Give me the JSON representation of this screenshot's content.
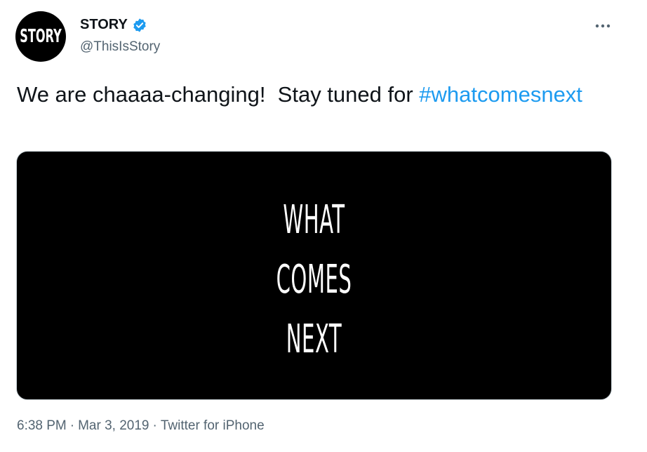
{
  "author": {
    "avatar_text": "STORY",
    "name": "STORY",
    "handle": "@ThisIsStory",
    "verified": true
  },
  "tweet": {
    "text": "We are chaaaa-changing!  Stay tuned for ",
    "hashtag": "#whatcomesnext"
  },
  "media": {
    "lines": [
      "WHAT",
      "COMES",
      "NEXT"
    ]
  },
  "meta": {
    "time": "6:38 PM",
    "date": "Mar 3, 2019",
    "source": "Twitter for iPhone",
    "separator": "·"
  },
  "icons": {
    "verified": "verified-badge-icon",
    "more": "more-icon"
  },
  "colors": {
    "link": "#1d9bf0",
    "text": "#0f1419",
    "secondary": "#536471",
    "media_bg": "#000000"
  }
}
